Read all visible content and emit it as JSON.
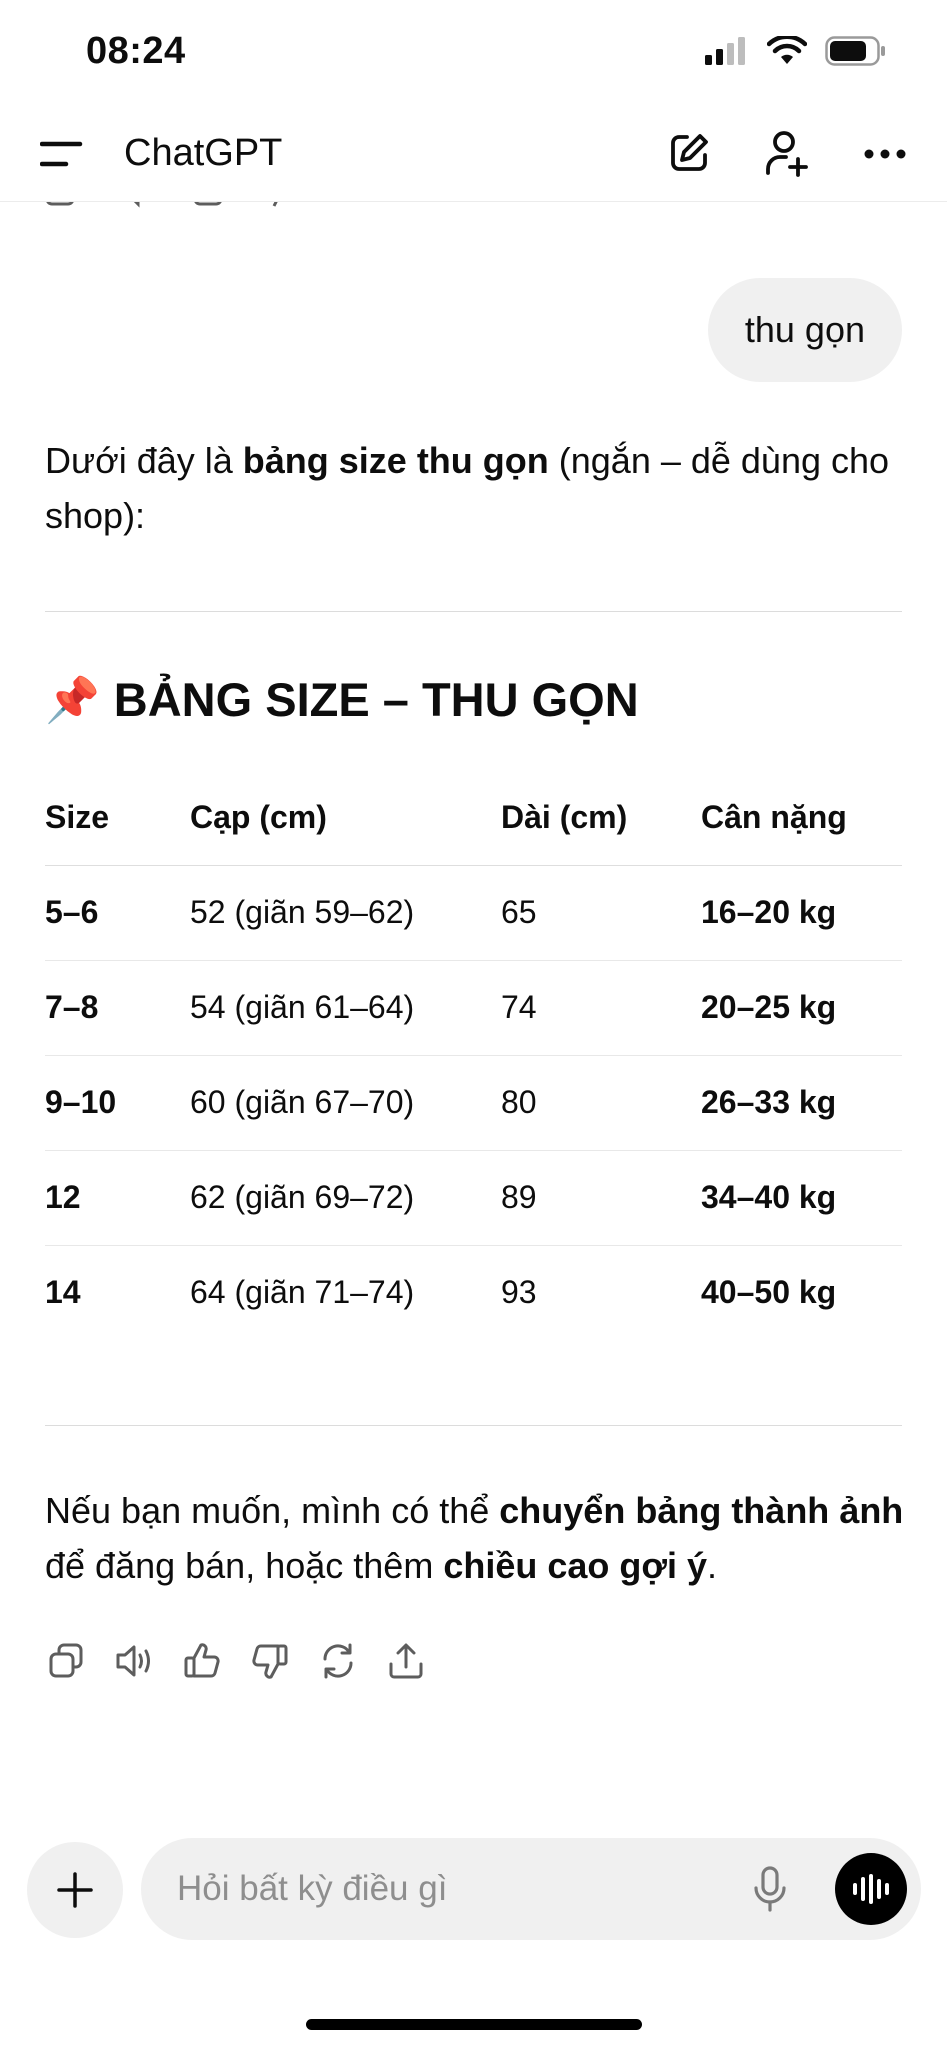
{
  "status_bar": {
    "time": "08:24",
    "icons": [
      "signal-icon",
      "wifi-icon",
      "battery-icon"
    ]
  },
  "header": {
    "title": "ChatGPT",
    "icons": [
      "menu-icon",
      "new-chat-icon",
      "add-person-icon",
      "more-icon"
    ]
  },
  "user_message": "thu gọn",
  "assistant": {
    "intro_pre": "Dưới đây là ",
    "intro_bold": "bảng size thu gọn",
    "intro_post": " (ngắn – dễ dùng cho shop):",
    "section_emoji": "📌",
    "section_title": "BẢNG SIZE – THU GỌN",
    "table": {
      "headers": [
        "Size",
        "Cạp (cm)",
        "Dài (cm)",
        "Cân nặng"
      ],
      "rows": [
        [
          "5–6",
          "52 (giãn 59–62)",
          "65",
          "16–20 kg"
        ],
        [
          "7–8",
          "54 (giãn 61–64)",
          "74",
          "20–25 kg"
        ],
        [
          "9–10",
          "60 (giãn 67–70)",
          "80",
          "26–33 kg"
        ],
        [
          "12",
          "62 (giãn 69–72)",
          "89",
          "34–40 kg"
        ],
        [
          "14",
          "64 (giãn 71–74)",
          "93",
          "40–50 kg"
        ]
      ]
    },
    "outro_pre": "Nếu bạn muốn, mình có thể ",
    "outro_bold1": "chuyển bảng thành ảnh",
    "outro_mid": " để đăng bán, hoặc thêm ",
    "outro_bold2": "chiều cao gợi ý",
    "outro_post": ".",
    "actions": [
      "copy-icon",
      "read-aloud-icon",
      "thumbs-up-icon",
      "thumbs-down-icon",
      "regenerate-icon",
      "share-icon"
    ]
  },
  "composer": {
    "placeholder": "Hỏi bất kỳ điều gì",
    "icons": [
      "plus-icon",
      "mic-icon",
      "voice-mode-icon"
    ]
  },
  "colors": {
    "text": "#0d0d0d",
    "bubble": "#f0f0f0",
    "placeholder": "#8e8e8e",
    "voice_button": "#000000"
  }
}
